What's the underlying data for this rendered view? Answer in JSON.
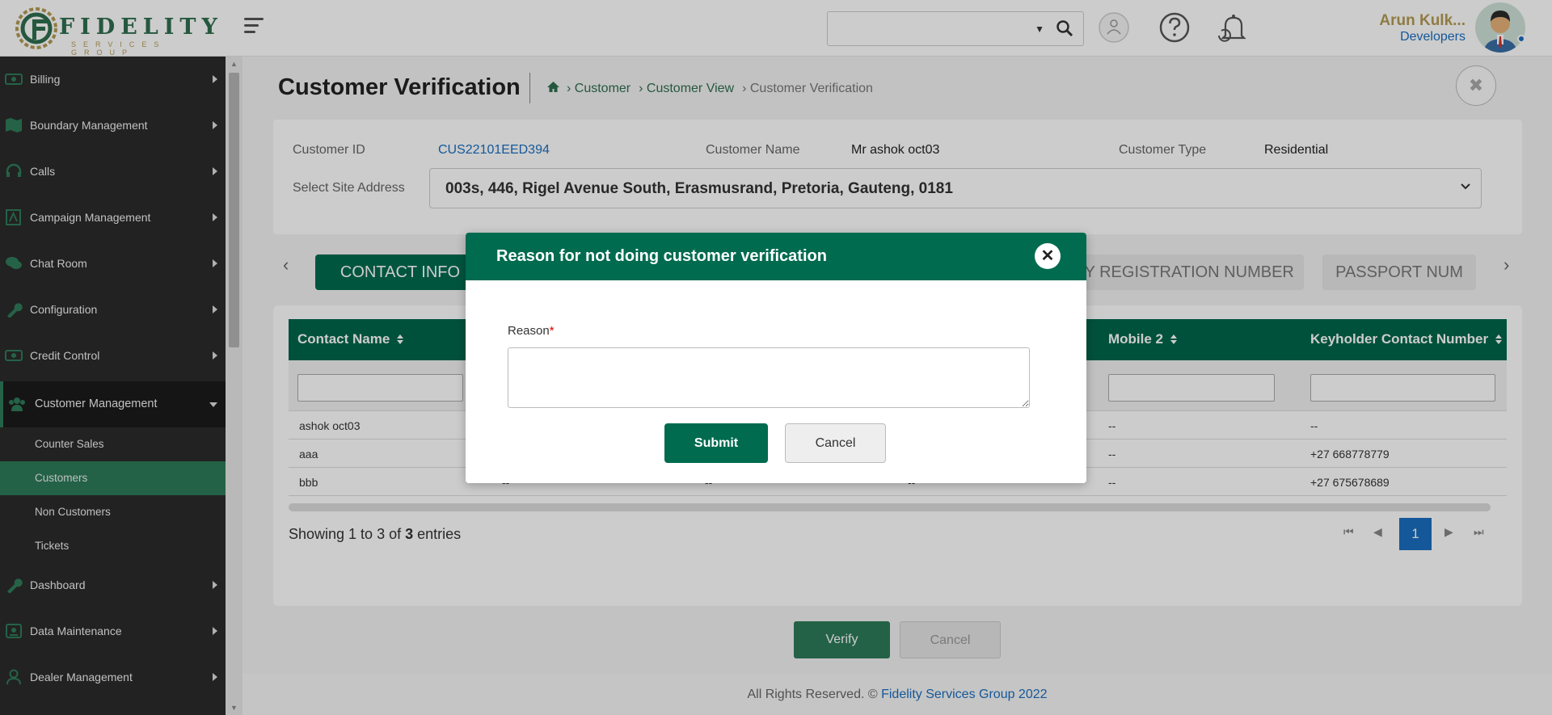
{
  "header": {
    "logo_word": "FIDELITY",
    "logo_sub": "SERVICES GROUP",
    "user_name": "Arun Kulk...",
    "user_role": "Developers"
  },
  "sidebar": {
    "items": [
      {
        "label": "Billing"
      },
      {
        "label": "Boundary Management"
      },
      {
        "label": "Calls"
      },
      {
        "label": "Campaign Management"
      },
      {
        "label": "Chat Room"
      },
      {
        "label": "Configuration"
      },
      {
        "label": "Credit Control"
      },
      {
        "label": "Customer Management"
      },
      {
        "label": "Dashboard"
      },
      {
        "label": "Data Maintenance"
      },
      {
        "label": "Dealer Management"
      }
    ],
    "sub_items": [
      {
        "label": "Counter Sales"
      },
      {
        "label": "Customers"
      },
      {
        "label": "Non Customers"
      },
      {
        "label": "Tickets"
      }
    ]
  },
  "page": {
    "title": "Customer Verification",
    "breadcrumb": [
      "› Customer",
      "› Customer View",
      "› Customer Verification"
    ]
  },
  "customer": {
    "id_label": "Customer ID",
    "id_value": "CUS22101EED394",
    "name_label": "Customer Name",
    "name_value": "Mr ashok oct03",
    "type_label": "Customer Type",
    "type_value": "Residential",
    "site_label": "Select Site Address",
    "site_value": "003s, 446, Rigel Avenue South, Erasmusrand, Pretoria, Gauteng, 0181"
  },
  "tabs": [
    "CONTACT INFO",
    "NY REGISTRATION NUMBER",
    "PASSPORT NUM"
  ],
  "table": {
    "headers": [
      "Contact Name",
      "Mobile 2",
      "Keyholder Contact Number"
    ],
    "rows": [
      {
        "name": "ashok oct03",
        "c2": "",
        "c3": "",
        "c4": "",
        "mobile2": "--",
        "keyholder": "--"
      },
      {
        "name": "aaa",
        "c2": "",
        "c3": "",
        "c4": "",
        "mobile2": "--",
        "keyholder": "+27 668778779"
      },
      {
        "name": "bbb",
        "c2": "--",
        "c3": "--",
        "c4": "--",
        "mobile2": "--",
        "keyholder": "+27 675678689"
      }
    ],
    "showing_prefix": "Showing 1 to 3 of ",
    "showing_total": "3",
    "showing_suffix": " entries",
    "current_page": "1"
  },
  "actions": {
    "verify": "Verify",
    "cancel": "Cancel"
  },
  "footer": {
    "text": "All Rights Reserved. © ",
    "brand": "Fidelity Services Group 2022"
  },
  "modal": {
    "title": "Reason for not doing customer verification",
    "reason_label": "Reason",
    "required_mark": "*",
    "reason_value": "",
    "submit": "Submit",
    "cancel": "Cancel"
  },
  "colors": {
    "brand_green": "#006b4f",
    "link_blue": "#1a6fc0",
    "gold": "#b59a53"
  }
}
